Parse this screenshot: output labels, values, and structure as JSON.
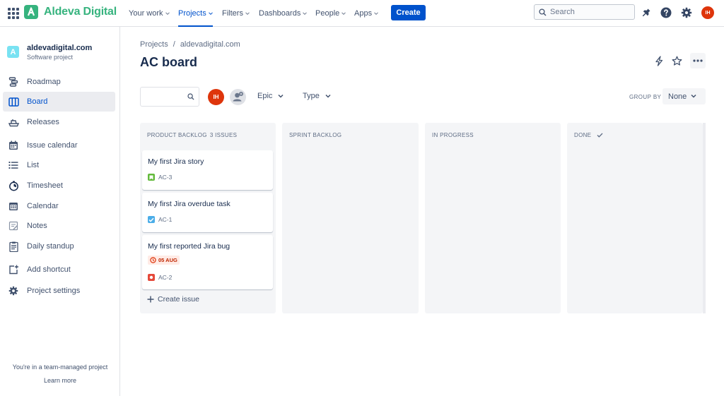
{
  "brand": {
    "name": "Aldeva Digital",
    "color": "#36b37e"
  },
  "topnav": {
    "items": [
      {
        "label": "Your work",
        "active": false
      },
      {
        "label": "Projects",
        "active": true
      },
      {
        "label": "Filters",
        "active": false
      },
      {
        "label": "Dashboards",
        "active": false
      },
      {
        "label": "People",
        "active": false
      },
      {
        "label": "Apps",
        "active": false
      }
    ],
    "create_label": "Create",
    "search_placeholder": "Search",
    "icons": [
      "notifications-icon",
      "help-icon",
      "settings-icon"
    ],
    "profile_initials": "IH"
  },
  "sidebar": {
    "project_name": "aldevadigital.com",
    "project_type": "Software project",
    "project_icon_letter": "A",
    "items": [
      {
        "label": "Roadmap",
        "icon": "roadmap-icon",
        "active": false
      },
      {
        "label": "Board",
        "icon": "board-icon",
        "active": true
      },
      {
        "label": "Releases",
        "icon": "releases-icon",
        "active": false
      },
      {
        "label": "Issue calendar",
        "icon": "issue-calendar-icon",
        "active": false
      },
      {
        "label": "List",
        "icon": "list-icon",
        "active": false
      },
      {
        "label": "Timesheet",
        "icon": "timesheet-icon",
        "active": false
      },
      {
        "label": "Calendar",
        "icon": "calendar-icon",
        "active": false
      },
      {
        "label": "Notes",
        "icon": "notes-icon",
        "active": false
      },
      {
        "label": "Daily standup",
        "icon": "daily-standup-icon",
        "active": false
      },
      {
        "label": "Add shortcut",
        "icon": "add-shortcut-icon",
        "active": false
      },
      {
        "label": "Project settings",
        "icon": "project-settings-icon",
        "active": false
      }
    ],
    "footer_text": "You're in a team-managed project",
    "learn_more": "Learn more"
  },
  "main": {
    "breadcrumb": [
      "Projects",
      "aldevadigital.com"
    ],
    "breadcrumb_sep": "/",
    "title": "AC board",
    "filters": {
      "epic": "Epic",
      "type": "Type"
    },
    "group_by_label": "GROUP BY",
    "group_by_value": "None",
    "assignee_initials": "IH"
  },
  "columns": [
    {
      "title": "PRODUCT BACKLOG",
      "count": "3 ISSUES",
      "cards": [
        {
          "summary": "My first Jira story",
          "key": "AC-3",
          "type": "story",
          "type_color": "#63ba3c",
          "due": ""
        },
        {
          "summary": "My first Jira overdue task",
          "key": "AC-1",
          "type": "task",
          "type_color": "#4bade8",
          "due": ""
        },
        {
          "summary": "My first reported Jira bug",
          "key": "AC-2",
          "type": "bug",
          "type_color": "#e5493a",
          "due": "05 AUG"
        }
      ],
      "create_label": "Create issue"
    },
    {
      "title": "SPRINT BACKLOG",
      "count": "",
      "cards": []
    },
    {
      "title": "IN PROGRESS",
      "count": "",
      "cards": []
    },
    {
      "title": "DONE",
      "count": "",
      "cards": [],
      "done_check": true
    }
  ]
}
